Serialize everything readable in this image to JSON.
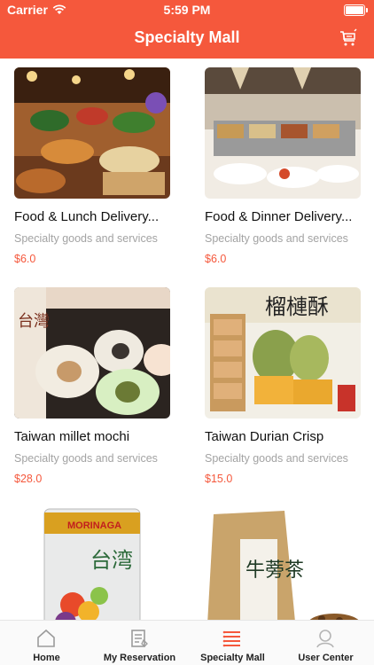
{
  "status_bar": {
    "carrier": "Carrier",
    "time": "5:59 PM"
  },
  "header": {
    "title": "Specialty Mall",
    "cart_icon": "cart-icon"
  },
  "products": [
    {
      "name": "Food & Lunch Delivery...",
      "desc": "Specialty goods and services",
      "price": "$6.0"
    },
    {
      "name": "Food & Dinner Delivery...",
      "desc": "Specialty goods and services",
      "price": "$6.0"
    },
    {
      "name": "Taiwan millet mochi",
      "desc": "Specialty goods and services",
      "price": "$28.0"
    },
    {
      "name": "Taiwan Durian Crisp",
      "desc": "Specialty goods and services",
      "price": "$15.0"
    },
    {
      "name": "",
      "desc": "",
      "price": ""
    },
    {
      "name": "",
      "desc": "",
      "price": ""
    }
  ],
  "package_texts": {
    "morinaga": "MORINAGA",
    "taiwan": "台湾",
    "durian": "榴槤酥",
    "mochi_side": "台灣",
    "tea": "牛蒡茶"
  },
  "tabs": [
    {
      "label": "Home",
      "icon": "home-icon"
    },
    {
      "label": "My Reservation",
      "icon": "reservation-icon"
    },
    {
      "label": "Specialty Mall",
      "icon": "list-icon"
    },
    {
      "label": "User Center",
      "icon": "user-icon"
    }
  ],
  "colors": {
    "accent": "#f5583c",
    "muted": "#a3a3a3"
  }
}
